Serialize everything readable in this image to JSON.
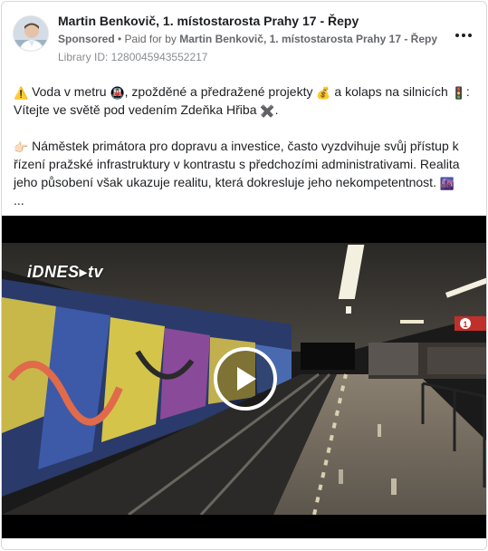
{
  "post": {
    "author": "Martin Benkovič, 1. místostarosta Prahy 17 - Řepy",
    "sponsored_label": "Sponsored",
    "separator": " • ",
    "paid_for_prefix": "Paid for by ",
    "paid_for_name": "Martin Benkovič, 1. místostarosta Prahy 17 - Řepy",
    "library_id": "Library ID: 1280045943552217",
    "more_icon": "more-horizontal-icon"
  },
  "body": {
    "p1": {
      "emoji_warning": "⚠️",
      "t1": " Voda v metru ",
      "emoji_metro": "🚇",
      "t2": ", zpožděné a předražené projekty ",
      "emoji_money": "💰",
      "t3": " a kolaps na silnicích ",
      "emoji_traffic": "🚦",
      "t4": ": Vítejte ve světě pod vedením Zdeňka Hřiba ",
      "emoji_cross": "✖️",
      "t5": "."
    },
    "p2": {
      "emoji_point": "👉🏻",
      "t1": " Náměstek primátora pro dopravu a investice, často vyzdvihuje svůj přístup k řízení pražské infrastruktury v kontrastu s předchozími administrativami. Realita jeho působení však ukazuje realitu, která dokresluje jeho nekompetentnost. ",
      "emoji_city": "🌆",
      "ellipsis": "..."
    }
  },
  "video": {
    "watermark": "iDNES▸tv",
    "play_icon": "play-icon",
    "platform_sign": "1"
  },
  "colors": {
    "text": "#1c1e21",
    "secondary": "#65676b",
    "muted": "#8a8d91",
    "border": "#d6d9dd"
  }
}
